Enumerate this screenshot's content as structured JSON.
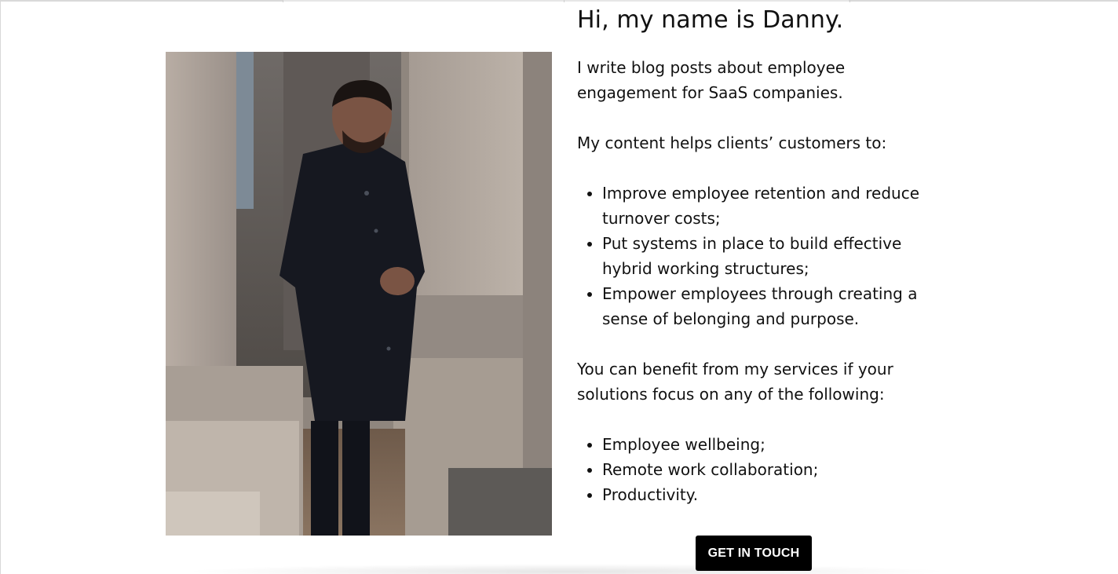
{
  "intro": {
    "heading": "Hi, my name is Danny.",
    "paragraph_1": "I write blog posts about employee engagement for SaaS companies.",
    "paragraph_2": "My content helps clients’ customers to:",
    "list_1": [
      "Improve employee retention and reduce turnover costs;",
      "Put systems in place to build effective hybrid working structures;",
      "Empower employees through creating a sense of belonging and purpose."
    ],
    "paragraph_3": "You can benefit from my services if your solutions focus on any of the following:",
    "list_2": [
      "Employee wellbeing;",
      "Remote work collaboration;",
      "Productivity."
    ]
  },
  "cta": {
    "label": "GET IN TOUCH"
  },
  "colors": {
    "background": "#ffffff",
    "text": "#111111",
    "button_bg": "#000000",
    "button_text": "#ffffff"
  }
}
